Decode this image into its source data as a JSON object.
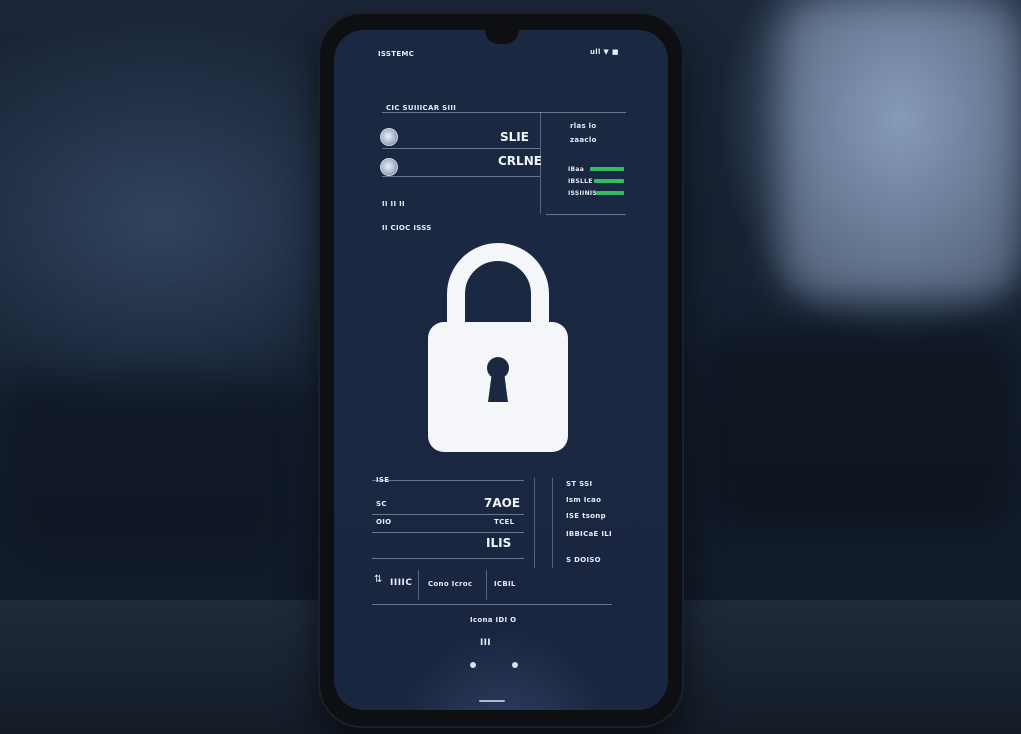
{
  "status_bar": {
    "left": "ISSTEMC",
    "right": "ull ▼ ■"
  },
  "header": {
    "label": "CIC SUIIICAR SIII"
  },
  "accounts": [
    {
      "value": "SLIE"
    },
    {
      "value": "CRLNE"
    }
  ],
  "side_panel": {
    "line1": "rlas lo",
    "line2": "zaaclo",
    "bars": [
      {
        "label": "IBaa"
      },
      {
        "label": "IBSLLE"
      },
      {
        "label": "ISSIINIS"
      }
    ]
  },
  "info": {
    "line1": "II II II",
    "line2": "II CIOC ISSS"
  },
  "lock": {
    "icon": "padlock-icon"
  },
  "details": {
    "rows": [
      {
        "label": "ISE",
        "value": ""
      },
      {
        "label": "SC",
        "value": "7AOE"
      },
      {
        "label": "OIO",
        "value": "TCEL"
      },
      {
        "label": "",
        "value": "ILIS"
      }
    ],
    "side": [
      "ST SSI",
      "Ism Icao",
      "ISE tsonp",
      "IBBICaE ILI",
      "S DOISO"
    ]
  },
  "footer_row": {
    "icon": "sliders-icon",
    "item1": "IIIIC",
    "item2": "Cono Icroc",
    "item3": "ICBIL"
  },
  "bottom": {
    "label": "Icona IDI O",
    "label2": "III"
  },
  "colors": {
    "screen_bg": "#1b2842",
    "accent_green": "#2fbf62",
    "text": "#e7ecf5"
  }
}
